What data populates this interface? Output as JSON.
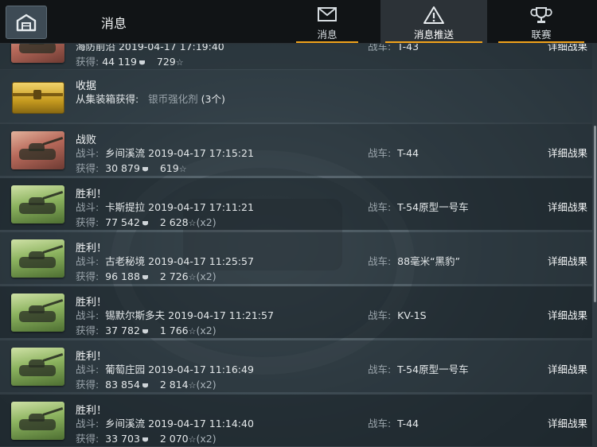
{
  "header": {
    "title": "消息",
    "tabs": [
      {
        "label": "消息",
        "icon": "envelope-icon"
      },
      {
        "label": "消息推送",
        "icon": "warning-icon",
        "active": true
      },
      {
        "label": "联赛",
        "icon": "trophy-icon"
      }
    ]
  },
  "labels": {
    "battle": "战斗:",
    "earned": "获得:",
    "tank": "战车:",
    "details": "详细战果"
  },
  "partial_row": {
    "map": "海防前沿 2019-04-17 17:19:40",
    "silver": "44 119",
    "xp": "729",
    "tank": "T-43"
  },
  "reward_row": {
    "title": "收据",
    "from": "从集装箱获得:",
    "item": "银币强化剂",
    "count": "(3个)"
  },
  "battles": [
    {
      "result": "战败",
      "map": "乡间溪流",
      "datetime": "2019-04-17 17:15:21",
      "silver": "30 879",
      "xp": "619",
      "mult": "",
      "tank": "T-44",
      "thumb": "defeat"
    },
    {
      "result": "胜利！",
      "map": "卡斯提拉",
      "datetime": "2019-04-17 17:11:21",
      "silver": "77 542",
      "xp": "2 628",
      "mult": "(x2)",
      "tank": "T-54原型一号车",
      "thumb": "victory"
    },
    {
      "result": "胜利！",
      "map": "古老秘境",
      "datetime": "2019-04-17 11:25:57",
      "silver": "96 188",
      "xp": "2 726",
      "mult": "(x2)",
      "tank": "88毫米“黑豹”",
      "thumb": "victory"
    },
    {
      "result": "胜利！",
      "map": "锡默尔斯多夫",
      "datetime": "2019-04-17 11:21:57",
      "silver": "37 782",
      "xp": "1 766",
      "mult": "(x2)",
      "tank": "KV-1S",
      "thumb": "victory"
    },
    {
      "result": "胜利！",
      "map": "葡萄庄园",
      "datetime": "2019-04-17 11:16:49",
      "silver": "83 854",
      "xp": "2 814",
      "mult": "(x2)",
      "tank": "T-54原型一号车",
      "thumb": "victory"
    },
    {
      "result": "胜利！",
      "map": "乡间溪流",
      "datetime": "2019-04-17 11:14:40",
      "silver": "33 703",
      "xp": "2 070",
      "mult": "(x2)",
      "tank": "T-44",
      "thumb": "victory"
    }
  ]
}
